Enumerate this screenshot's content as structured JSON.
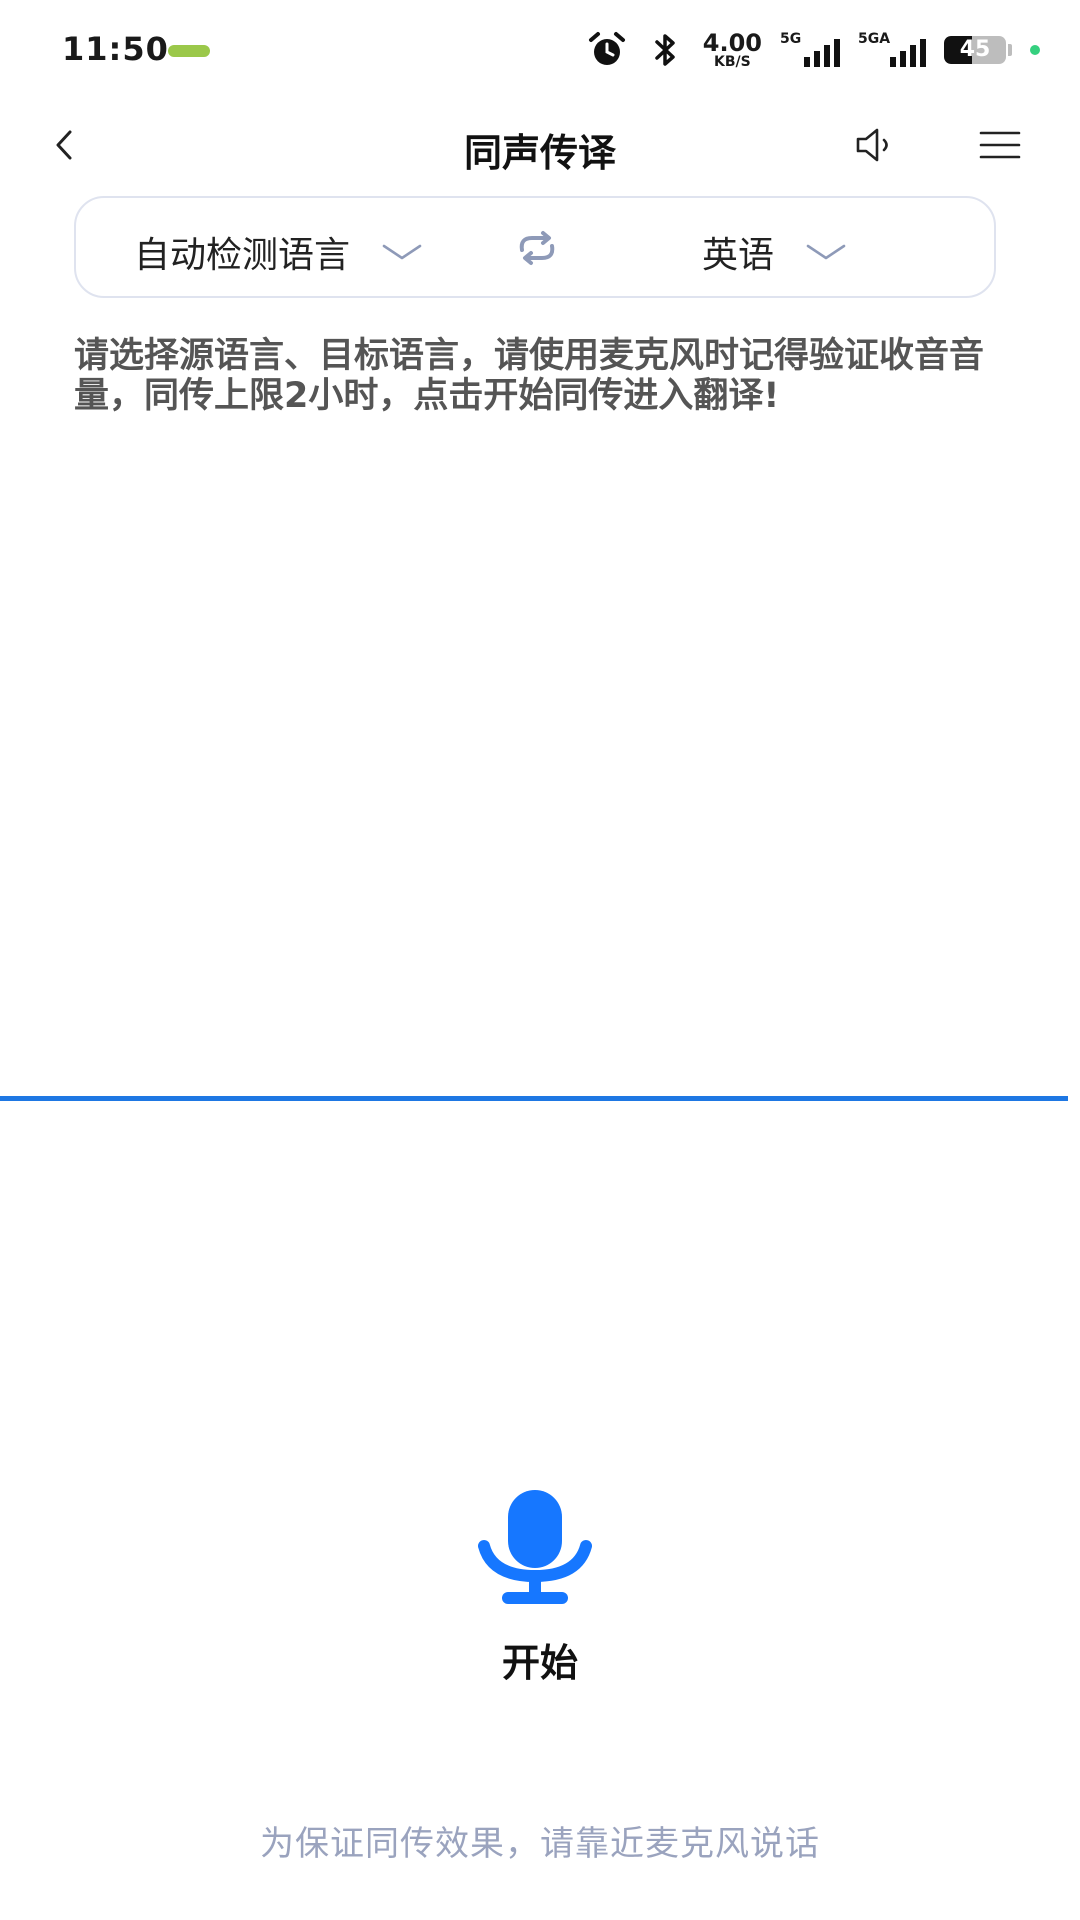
{
  "status_bar": {
    "time": "11:50",
    "net_speed_value": "4.00",
    "net_speed_unit": "KB/S",
    "signal1_tag": "5G",
    "signal2_tag": "5GA",
    "battery_level": "45",
    "battery_percent": 45,
    "icons": [
      "app-notification-icon",
      "alarm-icon",
      "bluetooth-icon",
      "signal-icon",
      "battery-icon",
      "privacy-dot-icon"
    ]
  },
  "header": {
    "title": "同声传译",
    "icons": [
      "back-chevron-icon",
      "speaker-icon",
      "menu-icon"
    ]
  },
  "language": {
    "source": "自动检测语言",
    "target": "英语",
    "icons": [
      "chevron-down-icon",
      "swap-icon"
    ]
  },
  "instruction": {
    "text": "请选择源语言、目标语言，请使用麦克风时记得验证收音音量，同传上限2小时，点击开始同传进入翻译!"
  },
  "controls": {
    "start_label": "开始",
    "mic_icon": "microphone-icon"
  },
  "footer": {
    "hint": "为保证同传效果，请靠近麦克风说话"
  },
  "colors": {
    "accent": "#1e77e3",
    "mic": "#1677ff",
    "hint_text": "#9aa3be",
    "instruction_text": "#555555",
    "status_dot": "#35d07f"
  }
}
